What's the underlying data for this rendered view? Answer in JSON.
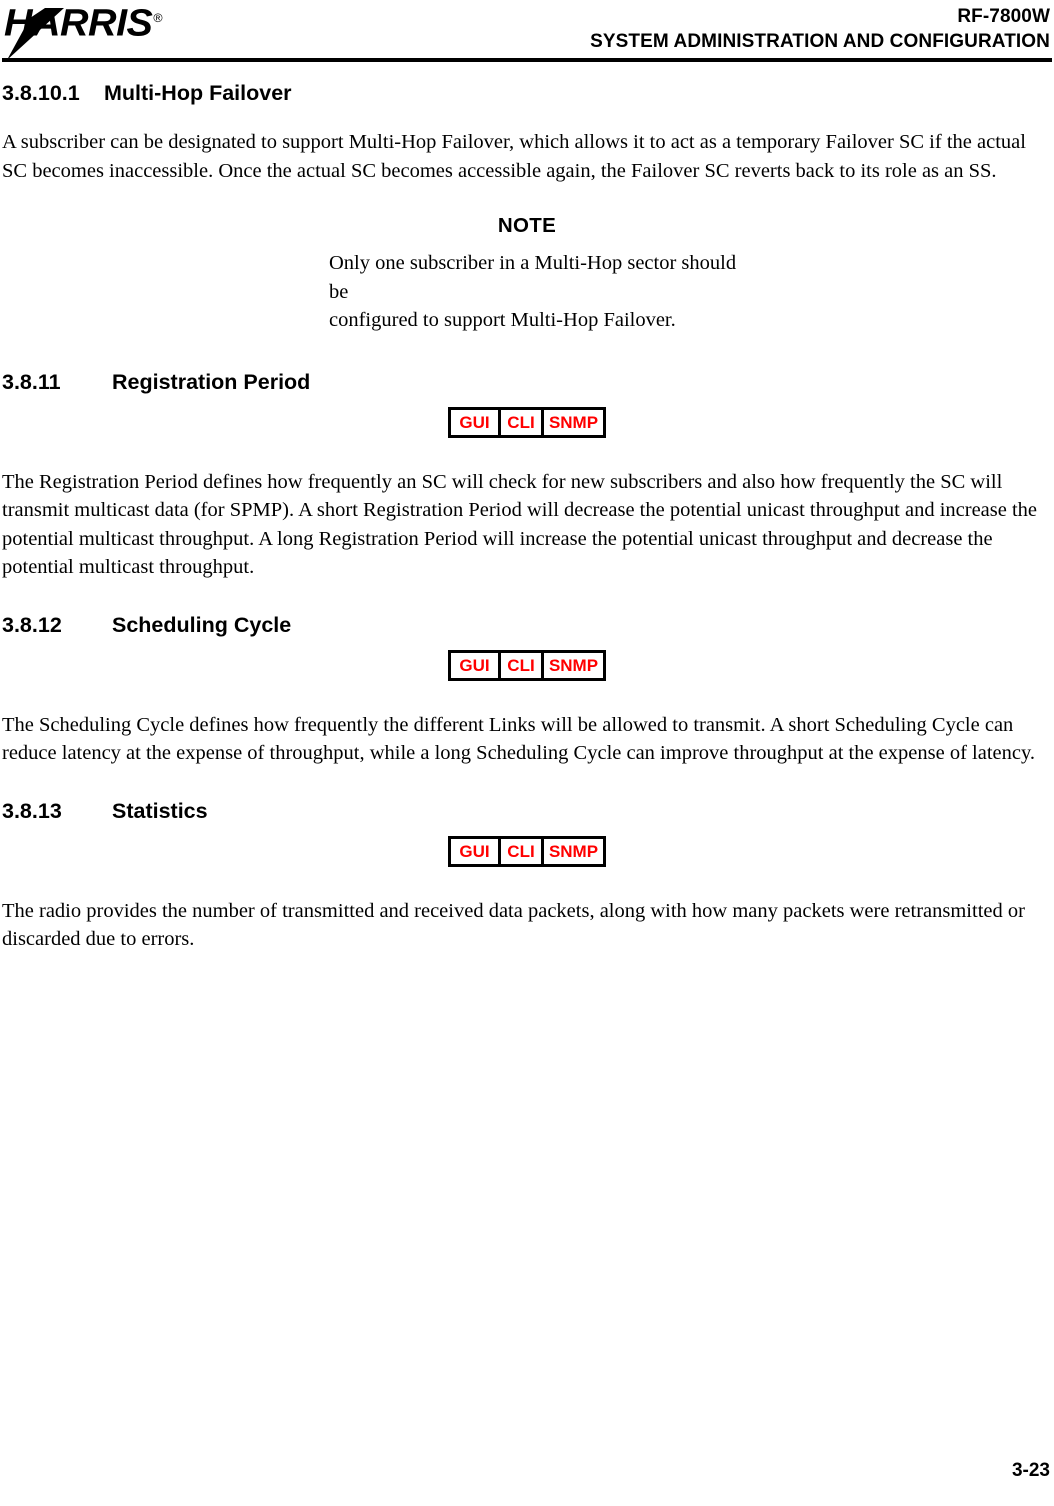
{
  "header": {
    "logo_text": "HARRIS",
    "logo_registered_mark": "®",
    "product_line": "RF-7800W",
    "manual_title": "SYSTEM ADMINISTRATION AND CONFIGURATION"
  },
  "sections": [
    {
      "number": "3.8.10.1",
      "title": "Multi-Hop Failover",
      "body": "A subscriber can be designated to support Multi-Hop Failover, which allows it to act as a temporary Failover SC if the actual SC becomes inaccessible. Once the actual SC becomes accessible again, the Failover SC reverts back to its role as an SS."
    },
    {
      "number": "3.8.11",
      "title": "Registration Period",
      "body": "The Registration Period defines how frequently an SC will check for new subscribers and also how frequently the SC will transmit multicast data (for SPMP). A short Registration Period will decrease the potential unicast throughput and increase the potential multicast throughput. A long Registration Period will increase the potential unicast throughput and decrease the potential multicast throughput."
    },
    {
      "number": "3.8.12",
      "title": "Scheduling Cycle",
      "body": "The Scheduling Cycle defines how frequently the different Links will be allowed to transmit. A short Scheduling Cycle can reduce latency at the expense of throughput, while a long Scheduling Cycle can improve throughput at the expense of latency."
    },
    {
      "number": "3.8.13",
      "title": "Statistics",
      "body": "The radio provides the number of transmitted and received data packets, along with how many packets were retransmitted or discarded due to errors."
    }
  ],
  "note": {
    "label": "NOTE",
    "line1": "Only one subscriber in a Multi-Hop sector should be",
    "line2": "configured to support Multi-Hop Failover."
  },
  "interface_badge": {
    "gui": "GUI",
    "cli": "CLI",
    "snmp": "SNMP",
    "text_color": "#ff0000",
    "border_color": "#000000"
  },
  "footer": {
    "page_number": "3-23"
  }
}
